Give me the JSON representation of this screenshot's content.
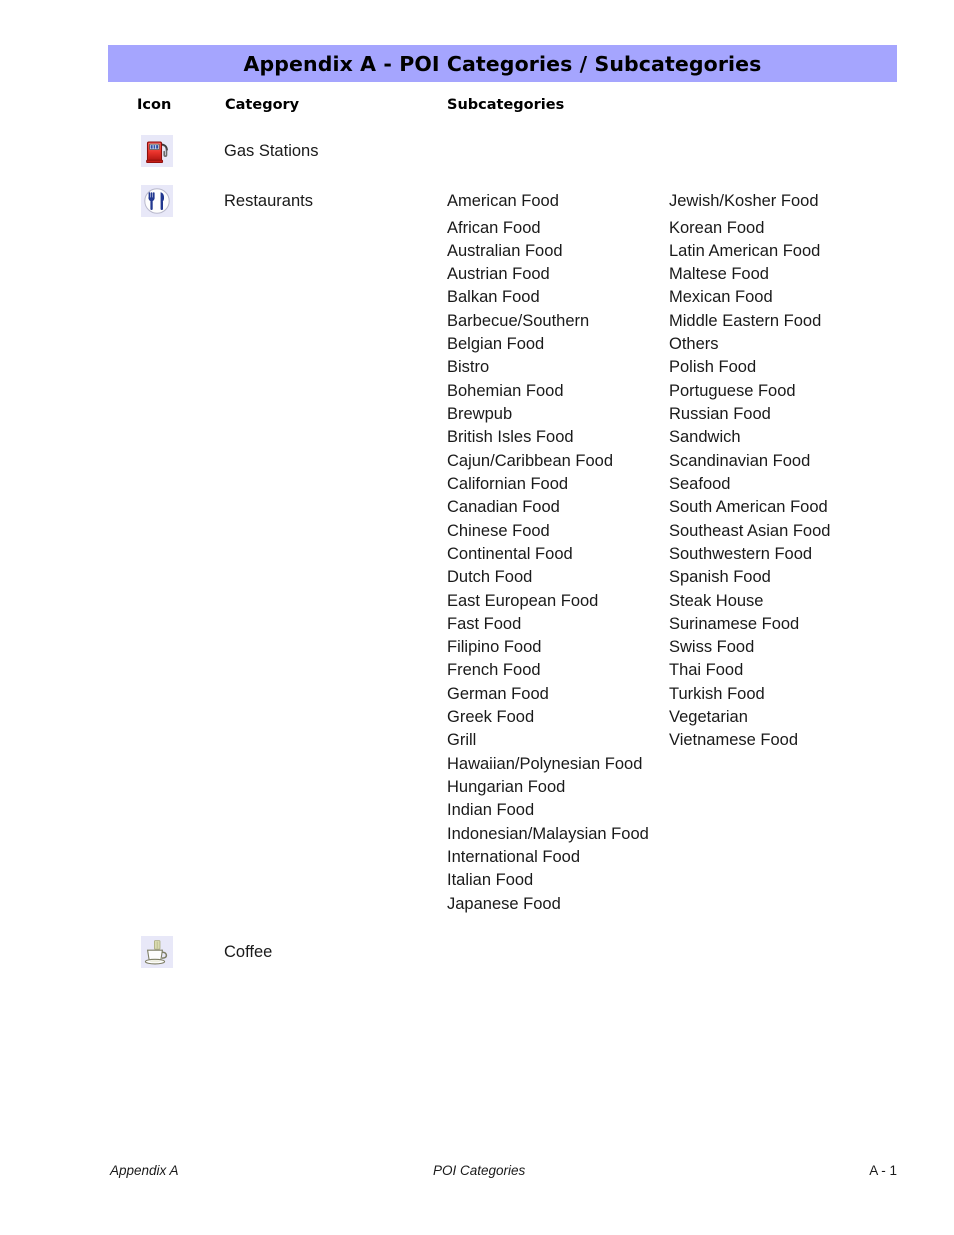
{
  "document": {
    "title": "Appendix A - POI Categories / Subcategories",
    "banner_color": "#a5a5fe"
  },
  "table": {
    "headers": {
      "icon": "Icon",
      "category": "Category",
      "subcategories": "Subcategories"
    },
    "rows": [
      {
        "icon_name": "gas-pump-icon",
        "category": "Gas Stations",
        "subcategories": []
      },
      {
        "icon_name": "restaurant-fork-knife-icon",
        "category": "Restaurants",
        "subcategories_left": [
          "American Food",
          "African Food",
          "Australian Food",
          "Austrian Food",
          "Balkan Food",
          "Barbecue/Southern",
          "Belgian Food",
          "Bistro",
          "Bohemian Food",
          "Brewpub",
          "British Isles Food",
          "Cajun/Caribbean Food",
          "Californian Food",
          "Canadian Food",
          "Chinese Food",
          "Continental Food",
          "Dutch Food",
          "East European Food",
          "Fast Food",
          "Filipino Food",
          "French Food",
          "German Food",
          "Greek Food",
          "Grill",
          "Hawaiian/Polynesian Food",
          "Hungarian Food",
          "Indian Food",
          "Indonesian/Malaysian Food",
          "International Food",
          "Italian Food",
          "Japanese Food"
        ],
        "subcategories_right": [
          "Jewish/Kosher Food",
          "Korean Food",
          "Latin American Food",
          "Maltese Food",
          "Mexican Food",
          "Middle Eastern Food",
          "Others",
          "Polish Food",
          "Portuguese Food",
          "Russian Food",
          "Sandwich",
          "Scandinavian Food",
          "Seafood",
          "South American Food",
          "Southeast Asian Food",
          "Southwestern Food",
          "Spanish Food",
          "Steak House",
          "Surinamese Food",
          "Swiss Food",
          "Thai Food",
          "Turkish Food",
          "Vegetarian",
          "Vietnamese Food"
        ]
      },
      {
        "icon_name": "coffee-cup-icon",
        "category": "Coffee",
        "subcategories": []
      }
    ]
  },
  "footer": {
    "left": "Appendix A",
    "center": "POI Categories",
    "right": "A - 1"
  }
}
